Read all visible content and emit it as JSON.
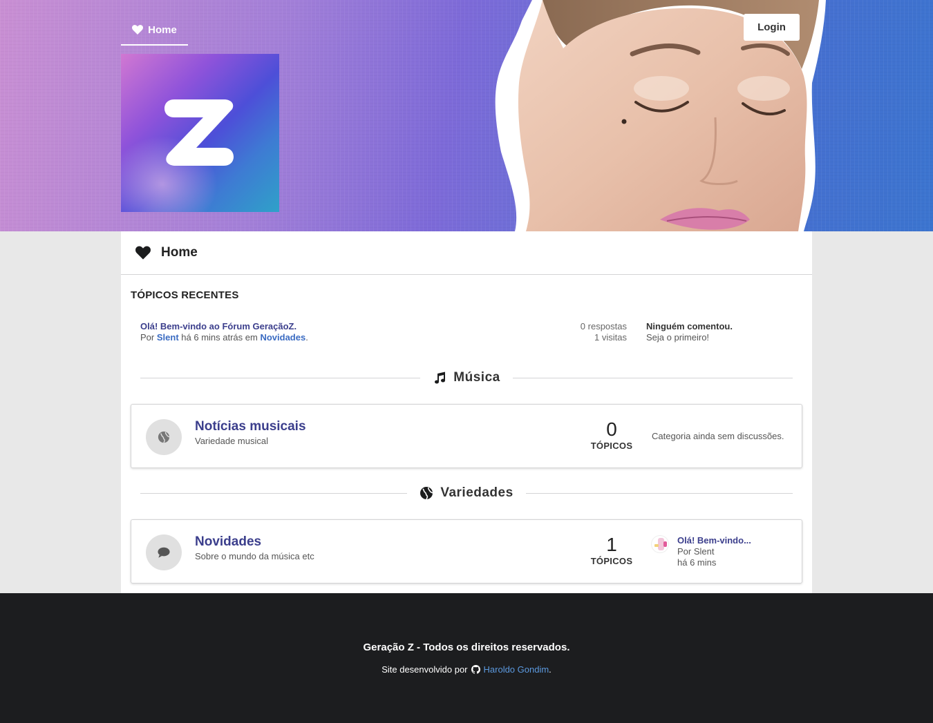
{
  "header": {
    "nav_home_label": "Home",
    "login_label": "Login",
    "logo_letter": "Z"
  },
  "page": {
    "title": "Home"
  },
  "recent": {
    "section_title": "TÓPICOS RECENTES",
    "topic_title": "Olá! Bem-vindo ao Fórum GeraçãoZ.",
    "by_prefix": "Por",
    "author": "Slent",
    "time_text": "há 6 mins atrás em",
    "category": "Novidades",
    "trailing_dot": ".",
    "replies": "0 respostas",
    "visits": "1 visitas",
    "last_title": "Ninguém comentou.",
    "last_sub": "Seja o primeiro!"
  },
  "categories": [
    {
      "heading": "Música",
      "heading_icon": "music-note-icon",
      "forum": {
        "title": "Notícias musicais",
        "description": "Variedade musical",
        "icon": "globe-icon",
        "count": "0",
        "count_label": "TÓPICOS",
        "empty_text": "Categoria ainda sem discussões."
      }
    },
    {
      "heading": "Variedades",
      "heading_icon": "globe-icon",
      "forum": {
        "title": "Novidades",
        "description": "Sobre o mundo da música etc",
        "icon": "comment-icon",
        "count": "1",
        "count_label": "TÓPICOS",
        "last_title": "Olá! Bem-vindo...",
        "last_author": "Por Slent",
        "last_time": "há 6 mins"
      }
    }
  ],
  "footer": {
    "copyright": "Geração Z - Todos os direitos reservados.",
    "dev_prefix": "Site desenvolvido por",
    "dev_name": "Haroldo Gondim",
    "dev_suffix": "."
  },
  "colors": {
    "link_primary": "#3b3e8c",
    "link_secondary": "#3a6bc2",
    "footer_bg": "#1c1d1f",
    "footer_link": "#5c9ae0"
  }
}
